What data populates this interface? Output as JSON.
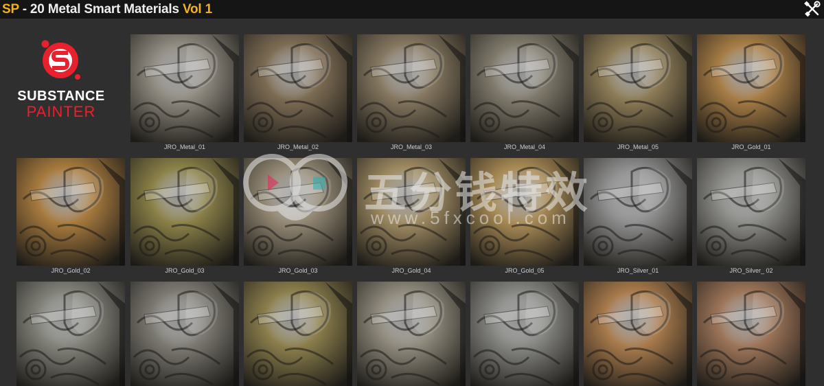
{
  "header": {
    "prefix": "SP",
    "title_main": " - 20 Metal Smart Materials ",
    "title_vol": "Vol 1",
    "accent_color": "#f2b21c",
    "tools_icon": "wrench-screwdriver-icon"
  },
  "logo": {
    "line1": "SUBSTANCE",
    "line2": "PAINTER",
    "brand_color": "#e8212e"
  },
  "materials": [
    {
      "label": "JRO_Metal_01",
      "row": 0,
      "col": 1,
      "tone": "#8f8a80"
    },
    {
      "label": "JRO_Metal_02",
      "row": 0,
      "col": 2,
      "tone": "#7d6c54"
    },
    {
      "label": "JRO_Metal_03",
      "row": 0,
      "col": 3,
      "tone": "#857760"
    },
    {
      "label": "JRO_Metal_04",
      "row": 0,
      "col": 4,
      "tone": "#807a6c"
    },
    {
      "label": "JRO_Metal_05",
      "row": 0,
      "col": 5,
      "tone": "#8c7b56"
    },
    {
      "label": "JRO_Gold_01",
      "row": 0,
      "col": 6,
      "tone": "#a67c45"
    },
    {
      "label": "JRO_Gold_02",
      "row": 1,
      "col": 0,
      "tone": "#a77a3e"
    },
    {
      "label": "JRO_Gold_03",
      "row": 1,
      "col": 1,
      "tone": "#8a8048"
    },
    {
      "label": "JRO_Gold_03",
      "row": 1,
      "col": 2,
      "tone": "#938874"
    },
    {
      "label": "JRO_Gold_04",
      "row": 1,
      "col": 3,
      "tone": "#9e8a62"
    },
    {
      "label": "JRO_Gold_05",
      "row": 1,
      "col": 4,
      "tone": "#a88a55"
    },
    {
      "label": "JRO_Silver_01",
      "row": 1,
      "col": 5,
      "tone": "#8d8d8d"
    },
    {
      "label": "JRO_Silver_ 02",
      "row": 1,
      "col": 6,
      "tone": "#8a8a86"
    },
    {
      "label": "",
      "row": 2,
      "col": 0,
      "tone": "#82827a"
    },
    {
      "label": "",
      "row": 2,
      "col": 1,
      "tone": "#7c7a72"
    },
    {
      "label": "",
      "row": 2,
      "col": 2,
      "tone": "#8b7e4c"
    },
    {
      "label": "",
      "row": 2,
      "col": 3,
      "tone": "#8f8a7c"
    },
    {
      "label": "",
      "row": 2,
      "col": 4,
      "tone": "#868682"
    },
    {
      "label": "",
      "row": 2,
      "col": 5,
      "tone": "#a87a4c"
    },
    {
      "label": "",
      "row": 2,
      "col": 6,
      "tone": "#9c7458"
    }
  ],
  "watermark": {
    "text_cn": "五分钱特效",
    "text_url": "www.5fxcool.com"
  }
}
